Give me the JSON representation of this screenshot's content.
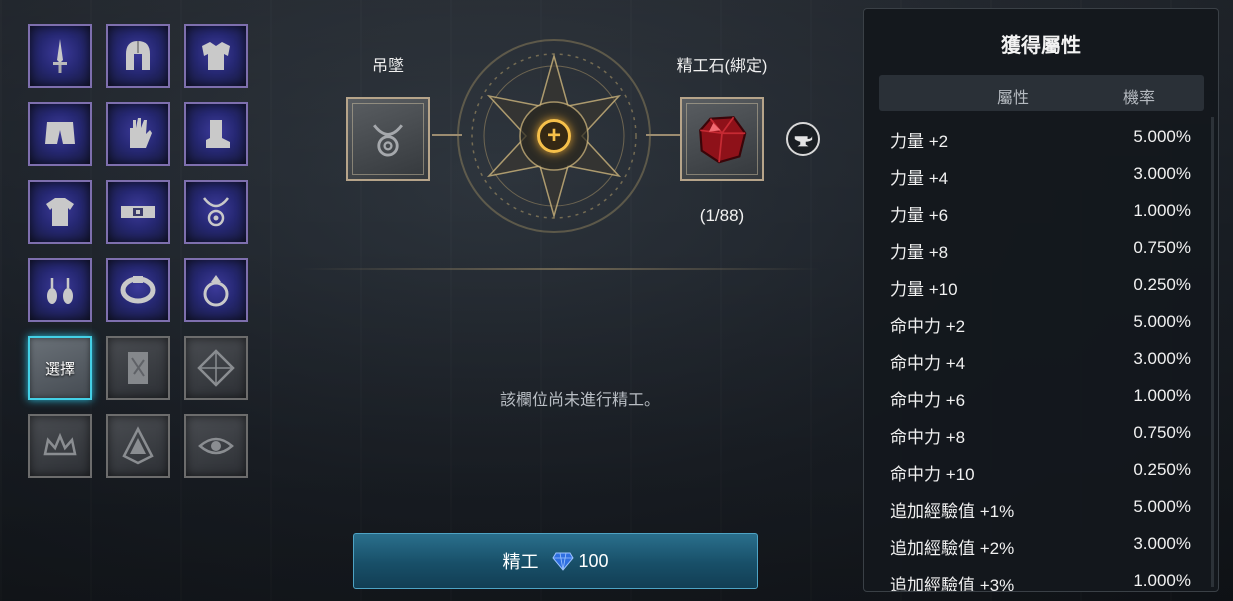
{
  "slots": {
    "select_label": "選擇"
  },
  "craft": {
    "left_label": "吊墜",
    "right_label": "精工石(綁定)",
    "stone_count": "(1/88)",
    "status_text": "該欄位尚未進行精工。",
    "button_label": "精工",
    "cost": "100"
  },
  "panel": {
    "title": "獲得屬性",
    "col_attr": "屬性",
    "col_rate": "機率",
    "rows": [
      {
        "attr": "力量 +2",
        "rate": "5.000%"
      },
      {
        "attr": "力量 +4",
        "rate": "3.000%"
      },
      {
        "attr": "力量 +6",
        "rate": "1.000%"
      },
      {
        "attr": "力量 +8",
        "rate": "0.750%"
      },
      {
        "attr": "力量 +10",
        "rate": "0.250%"
      },
      {
        "attr": "命中力 +2",
        "rate": "5.000%"
      },
      {
        "attr": "命中力 +4",
        "rate": "3.000%"
      },
      {
        "attr": "命中力 +6",
        "rate": "1.000%"
      },
      {
        "attr": "命中力 +8",
        "rate": "0.750%"
      },
      {
        "attr": "命中力 +10",
        "rate": "0.250%"
      },
      {
        "attr": "追加經驗值 +1%",
        "rate": "5.000%"
      },
      {
        "attr": "追加經驗值 +2%",
        "rate": "3.000%"
      },
      {
        "attr": "追加經驗值 +3%",
        "rate": "1.000%"
      }
    ]
  }
}
